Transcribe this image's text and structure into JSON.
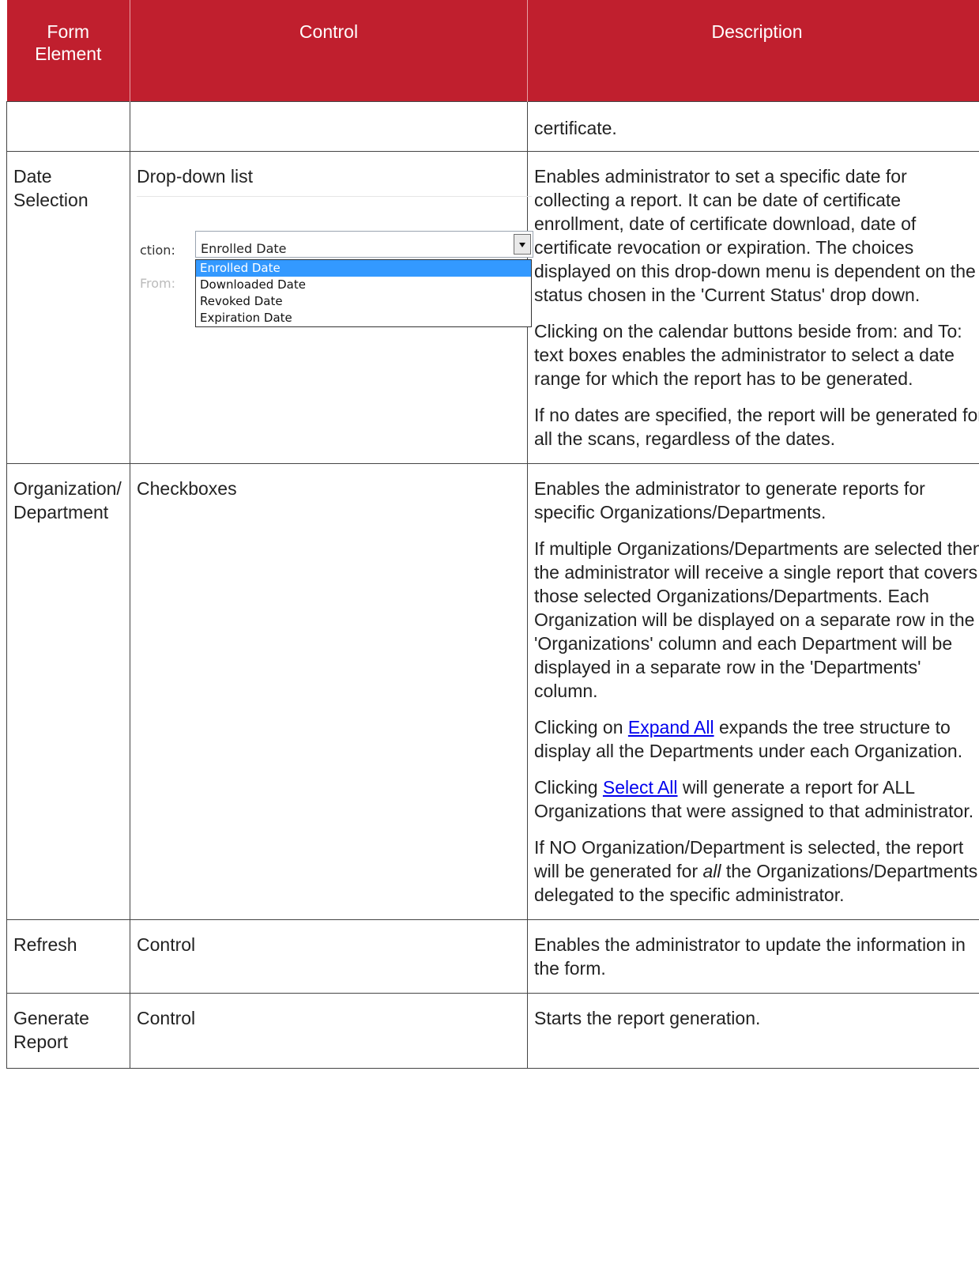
{
  "table": {
    "headers": {
      "form_element": "Form Element",
      "control": "Control",
      "description": "Description"
    },
    "rows": [
      {
        "form_element": "",
        "control": "",
        "description": [
          "certificate."
        ]
      },
      {
        "form_element": "Date Selection",
        "control": "Drop-down list",
        "description": [
          "Enables administrator to set a specific date for collecting a report. It can be date of certificate enrollment, date of certificate download, date of certificate revocation or expiration. The choices displayed on this drop-down menu is dependent on the status chosen in the 'Current Status' drop down.",
          "Clicking on the calendar buttons beside from: and To: text boxes enables the administrator to select a date range for which the report has to be generated.",
          "If no dates are specified, the report will be generated for all the scans, regardless of the dates."
        ]
      },
      {
        "form_element": "Organization/ Department",
        "control": "Checkboxes",
        "description": [
          "Enables the administrator to generate reports for specific Organizations/Departments.",
          "If multiple Organizations/Departments are selected then the administrator will receive a single report that covers those selected Organizations/Departments. Each Organization will be displayed on a separate row in the 'Organizations' column and each Department will be displayed in a separate row in the 'Departments' column."
        ],
        "expand_all": {
          "before": "Clicking on ",
          "link": "Expand All",
          "after": " expands the tree structure to display all the Departments under each Organization."
        },
        "select_all": {
          "before": "Clicking ",
          "link": "Select All",
          "after": " will generate a report for ALL Organizations that were assigned to that administrator."
        },
        "no_org": {
          "before": "If NO Organization/Department is selected, the report will be generated for ",
          "em": "all",
          "after": " the Organizations/Departments, delegated to the specific administrator."
        }
      },
      {
        "form_element": "Refresh",
        "control": "Control",
        "description": [
          "Enables the administrator to update the information in the form."
        ]
      },
      {
        "form_element": "Generate Report",
        "control": "Control",
        "description": [
          "Starts the report generation."
        ]
      }
    ]
  },
  "dropdown": {
    "label": "ction:",
    "label_from": "From:",
    "selected": "Enrolled Date",
    "options": [
      "Enrolled Date",
      "Downloaded Date",
      "Revoked Date",
      "Expiration Date"
    ],
    "colors": {
      "highlight": "#3399ff"
    }
  },
  "colors": {
    "header_bg": "#c01f2e",
    "link": "#0000ee"
  }
}
